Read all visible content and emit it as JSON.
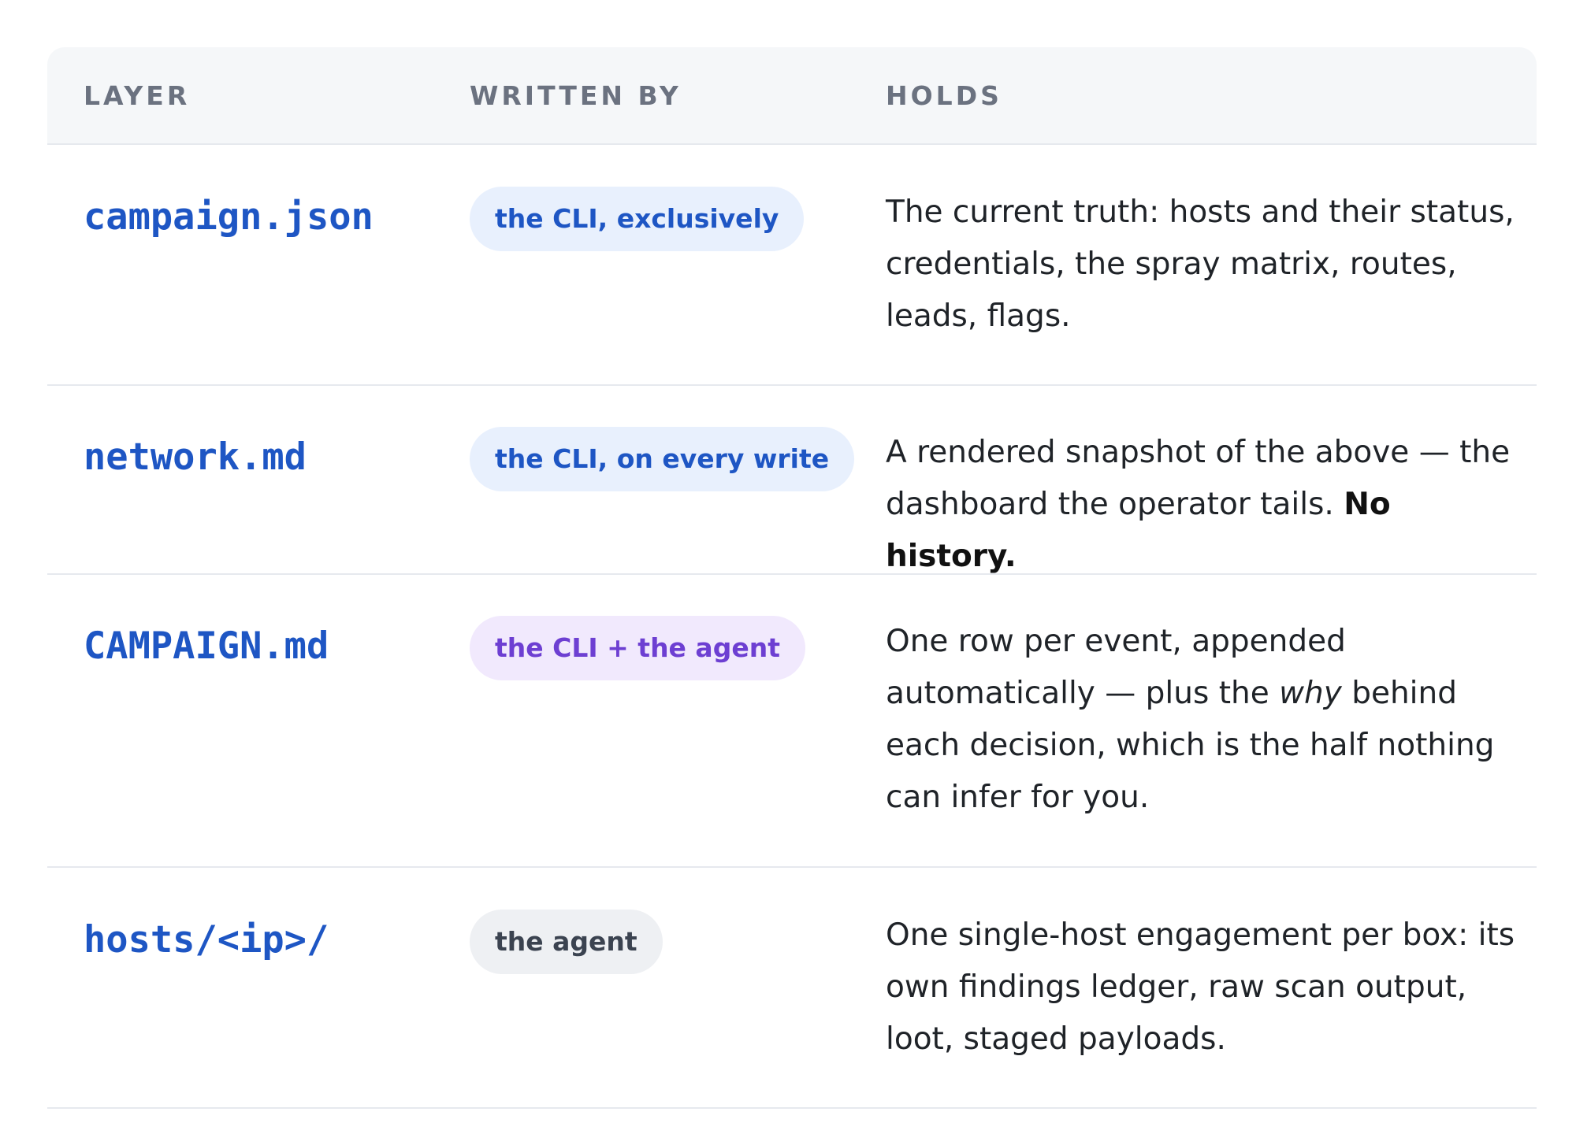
{
  "columns": [
    "LAYER",
    "WRITTEN BY",
    "HOLDS"
  ],
  "rows": [
    {
      "layer": "campaign.json",
      "written_by": "the CLI, exclusively",
      "written_by_color": "#e8f0fd",
      "holds": "The current truth: hosts and their status, credentials, the spray matrix, routes, leads, flags."
    },
    {
      "layer": "network.md",
      "written_by": "the CLI, on every write",
      "written_by_color": "#e8f0fd",
      "holds_pre": "A rendered snapshot of the above — the dashboard the operator tails.",
      "holds_bold": "No history."
    },
    {
      "layer": "CAMPAIGN.md",
      "written_by": "the CLI + the agent",
      "written_by_color": "#f1e9fd",
      "holds_pre": "One row per event, appended automatically — plus the",
      "holds_italic": "why",
      "holds_post": "behind each decision, which is the half nothing can infer for you."
    },
    {
      "layer": "hosts/<ip>/",
      "written_by": "the agent",
      "written_by_color": "#eef0f3",
      "holds": "One single-host engagement per box: its own findings ledger, raw scan output, loot, staged payloads."
    }
  ]
}
